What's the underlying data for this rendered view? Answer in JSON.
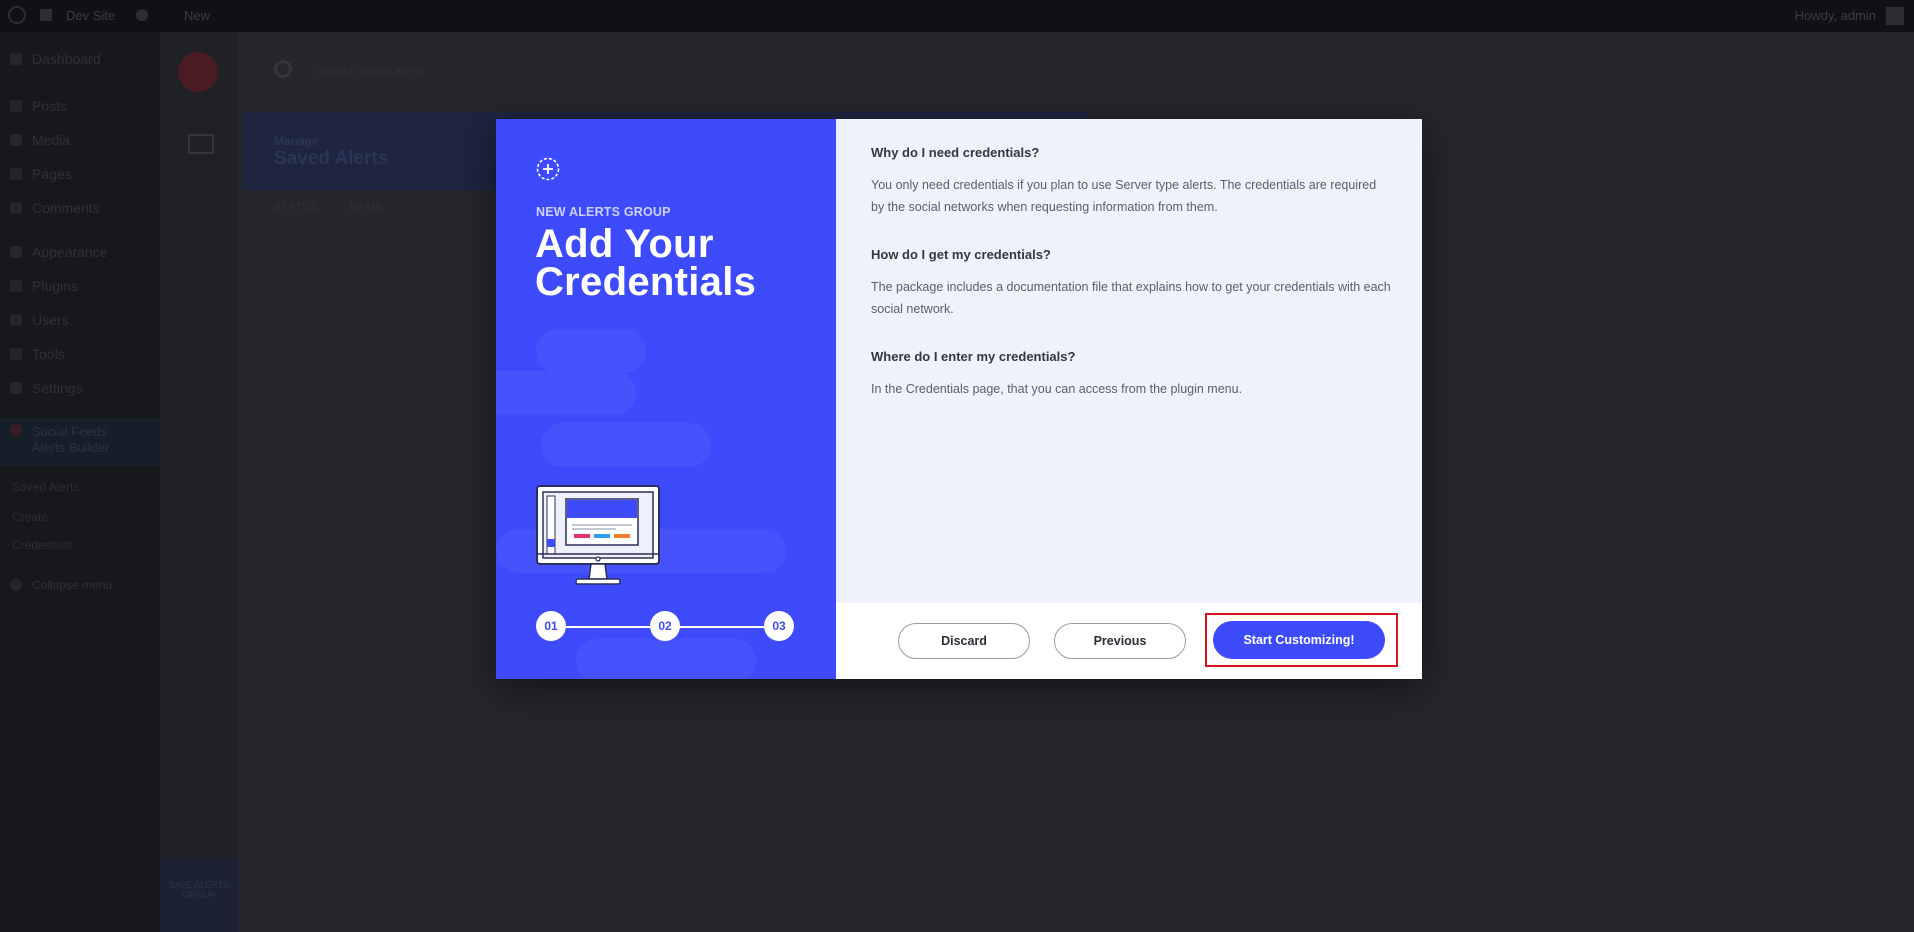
{
  "admin_bar": {
    "site_name": "Dev Site",
    "new_label": "New",
    "howdy": "Howdy, admin"
  },
  "sidebar": {
    "items": [
      {
        "label": "Dashboard"
      },
      {
        "label": "Posts"
      },
      {
        "label": "Media"
      },
      {
        "label": "Pages"
      },
      {
        "label": "Comments"
      },
      {
        "label": "Appearance"
      },
      {
        "label": "Plugins"
      },
      {
        "label": "Users"
      },
      {
        "label": "Tools"
      },
      {
        "label": "Settings"
      }
    ],
    "active_item": "Social Feeds Alerts Builder",
    "submenu": [
      "Saved Alerts",
      "Create",
      "Credentials"
    ],
    "collapse_label": "Collapse menu"
  },
  "plugin": {
    "search_placeholder": "Search saved alerts",
    "header_small": "Manage",
    "header_title": "Saved Alerts",
    "table_headers": [
      "STATUS",
      "NAME"
    ],
    "rail_bottom_label": "SAVE ALERTS GROUP"
  },
  "modal": {
    "overline": "NEW ALERTS GROUP",
    "title": "Add Your Credentials",
    "steps": [
      "01",
      "02",
      "03"
    ],
    "current_step": 3,
    "faqs": [
      {
        "question": "Why do I need credentials?",
        "answer": "You only need credentials if you plan to use Server type alerts. The credentials are required by the social networks when requesting information from them."
      },
      {
        "question": "How do I get my credentials?",
        "answer": "The package includes a documentation file that explains how to get your credentials with each social network."
      },
      {
        "question": "Where do I enter my credentials?",
        "answer": "In the Credentials page, that you can access from the plugin menu."
      }
    ],
    "buttons": {
      "discard": "Discard",
      "previous": "Previous",
      "start": "Start Customizing!"
    }
  },
  "colors": {
    "accent": "#3d4bfc",
    "highlight": "#d0161c",
    "panel_bg": "#eff1fc"
  }
}
